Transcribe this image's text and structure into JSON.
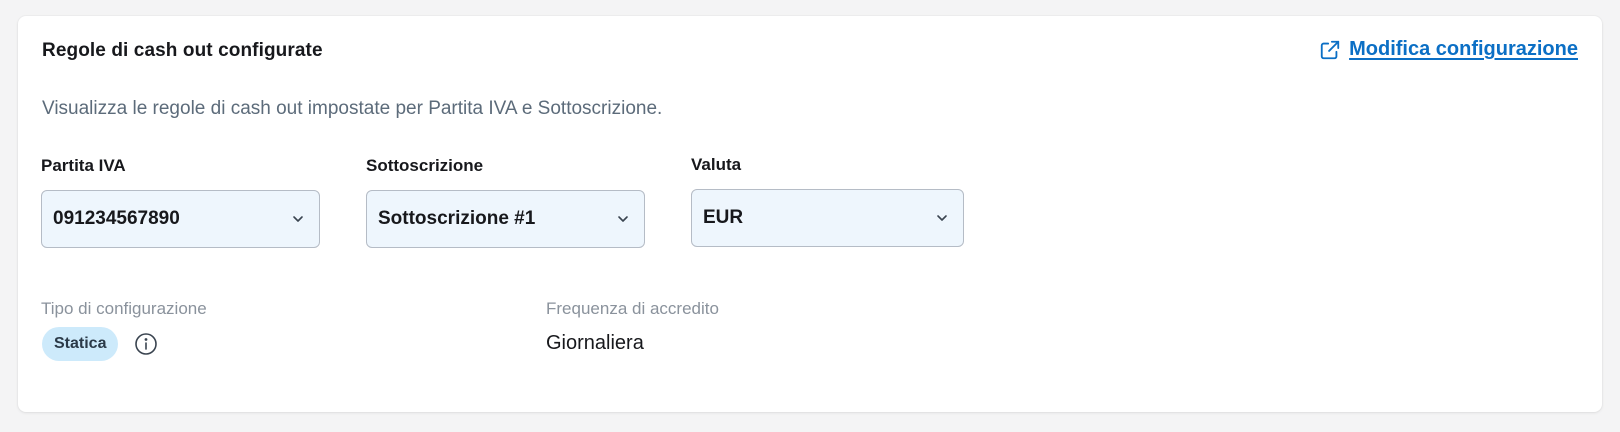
{
  "card": {
    "title": "Regole di cash out configurate",
    "edit_link": {
      "label": "Modifica configurazione",
      "icon": "external-link-icon"
    },
    "description": "Visualizza le regole di cash out impostate per Partita IVA e Sottoscrizione."
  },
  "filters": {
    "vat": {
      "label": "Partita IVA",
      "value": "091234567890"
    },
    "subscription": {
      "label": "Sottoscrizione",
      "value": "Sottoscrizione #1"
    },
    "currency": {
      "label": "Valuta",
      "value": "EUR"
    }
  },
  "details": {
    "config_type": {
      "label": "Tipo di configurazione",
      "value": "Statica"
    },
    "frequency": {
      "label": "Frequenza di accredito",
      "value": "Giornaliera"
    }
  },
  "colors": {
    "accent": "#0b6fc5",
    "select_bg": "#eef6fd",
    "badge_bg": "#cdeafb",
    "muted_text": "#8a929c"
  }
}
